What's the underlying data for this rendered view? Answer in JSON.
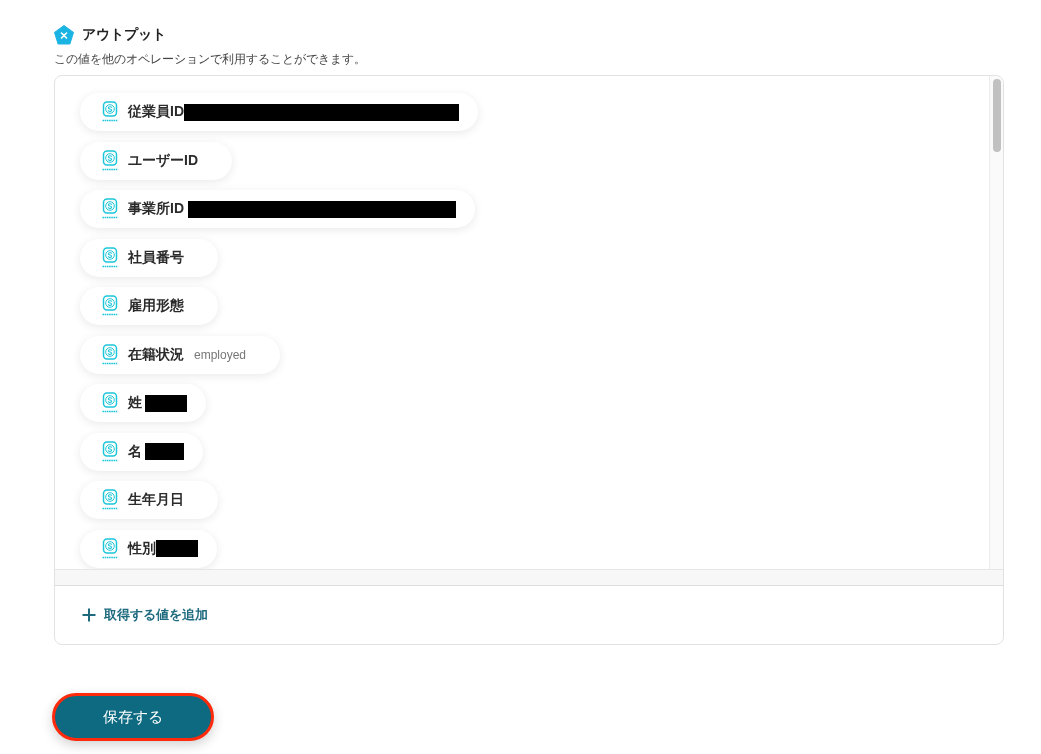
{
  "section": {
    "title": "アウトプット",
    "description": "この値を他のオペレーションで利用することができます。"
  },
  "outputs": [
    {
      "label": "従業員ID",
      "redacted": true
    },
    {
      "label": "ユーザーID",
      "redacted": false
    },
    {
      "label": "事業所ID",
      "redacted": true
    },
    {
      "label": "社員番号",
      "redacted": false
    },
    {
      "label": "雇用形態",
      "redacted": false
    },
    {
      "label": "在籍状況",
      "value": "employed",
      "redacted": false
    },
    {
      "label": "姓",
      "redacted": true
    },
    {
      "label": "名",
      "redacted": true
    },
    {
      "label": "生年月日",
      "redacted": false
    },
    {
      "label": "性別",
      "redacted": true
    }
  ],
  "add_button": {
    "label": "取得する値を追加"
  },
  "save_button": {
    "label": "保存する",
    "highlighted": true
  }
}
